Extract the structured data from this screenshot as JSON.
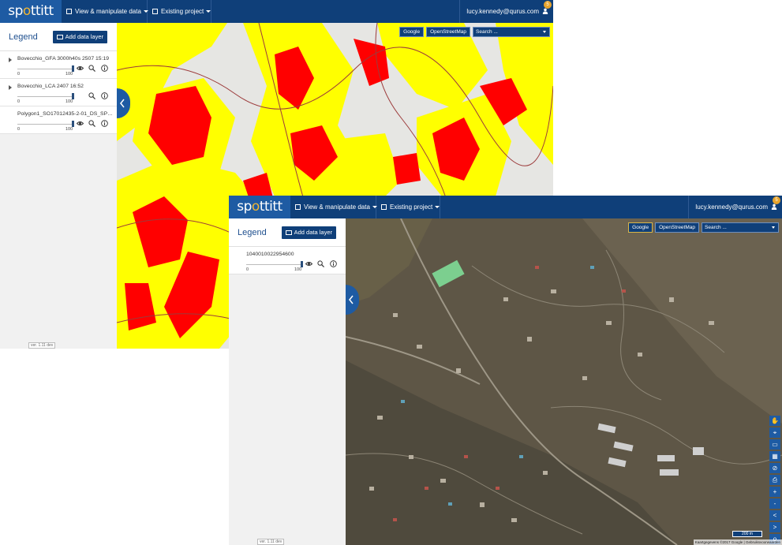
{
  "app": {
    "logo_text_pre": "sp",
    "logo_text_dot": "o",
    "logo_text_post": "ttitt",
    "nav_view": "View & manipulate data",
    "nav_project": "Existing project",
    "user_email": "lucy.kennedy@qurus.com",
    "notification_count": "5",
    "version": "ver. 1.11 dev"
  },
  "legend": {
    "title": "Legend",
    "add_button": "Add data layer"
  },
  "map_controls": {
    "google": "Google",
    "osm": "OpenStreetMap",
    "search_placeholder": "Search ..."
  },
  "window_back": {
    "layers": [
      {
        "name": "Bovecchio_GFA 3000h40s 2507 15:19",
        "min": "0",
        "max": "100",
        "opacity": 100
      },
      {
        "name": "Bovecchio_LCA 2407 16:52",
        "min": "0",
        "max": "100",
        "opacity": 100
      },
      {
        "name": "Polygon1_SO17012435-2-01_DS_SPOT...",
        "min": "0",
        "max": "100",
        "opacity": 100
      }
    ]
  },
  "window_front": {
    "layers": [
      {
        "name": "1040010022954600",
        "min": "0",
        "max": "100",
        "opacity": 100
      }
    ],
    "scale_label": "200 m",
    "attribution": "Kaartgegevens ©2017 Google | Gebruiksvoorwaarden"
  },
  "colors": {
    "header": "#0f3f79",
    "logo_bg": "#1e5ba3",
    "accent": "#1e5ba3",
    "map_yellow": "#ffff00",
    "map_red": "#ff0000"
  },
  "icons": {
    "eye": "eye-icon",
    "zoom": "zoom-icon",
    "info": "info-icon",
    "user": "user-icon"
  }
}
